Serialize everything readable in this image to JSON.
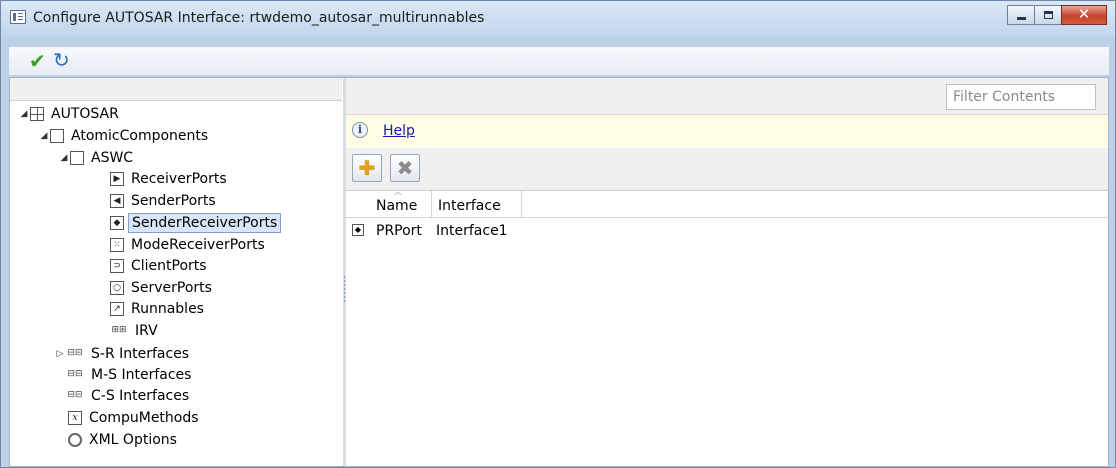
{
  "window": {
    "title": "Configure AUTOSAR Interface: rtwdemo_autosar_multirunnables",
    "controls": {
      "minimize": "minimize",
      "maximize": "maximize",
      "close": "✕"
    }
  },
  "toolbar": {
    "apply_icon": "check-icon",
    "refresh_icon": "refresh-icon",
    "apply_glyph": "✔",
    "refresh_glyph": "↻"
  },
  "tree": {
    "root": {
      "label": "AUTOSAR",
      "expanded": true
    },
    "atomic": {
      "label": "AtomicComponents",
      "expanded": true
    },
    "aswc": {
      "label": "ASWC",
      "expanded": true
    },
    "ports": [
      {
        "label": "ReceiverPorts",
        "glyph": "▶"
      },
      {
        "label": "SenderPorts",
        "glyph": "◀"
      },
      {
        "label": "SenderReceiverPorts",
        "glyph": "◆",
        "selected": true
      },
      {
        "label": "ModeReceiverPorts",
        "glyph": "⁙"
      },
      {
        "label": "ClientPorts",
        "glyph": "⊃"
      },
      {
        "label": "ServerPorts",
        "glyph": "○"
      },
      {
        "label": "Runnables",
        "glyph": "↗"
      },
      {
        "label": "IRV",
        "glyph": "⊞⊞"
      }
    ],
    "interfaces": [
      {
        "label": "S-R Interfaces",
        "collapsed": true
      },
      {
        "label": "M-S Interfaces"
      },
      {
        "label": "C-S Interfaces"
      }
    ],
    "compu": {
      "label": "CompuMethods",
      "glyph": "x"
    },
    "xml": {
      "label": "XML Options"
    }
  },
  "right": {
    "filter_placeholder": "Filter Contents",
    "help_label": "Help",
    "info_glyph": "i",
    "add_glyph": "✚",
    "delete_glyph": "✖",
    "columns": [
      "Name",
      "Interface"
    ],
    "rows": [
      {
        "name": "PRPort",
        "interface": "Interface1"
      }
    ]
  }
}
